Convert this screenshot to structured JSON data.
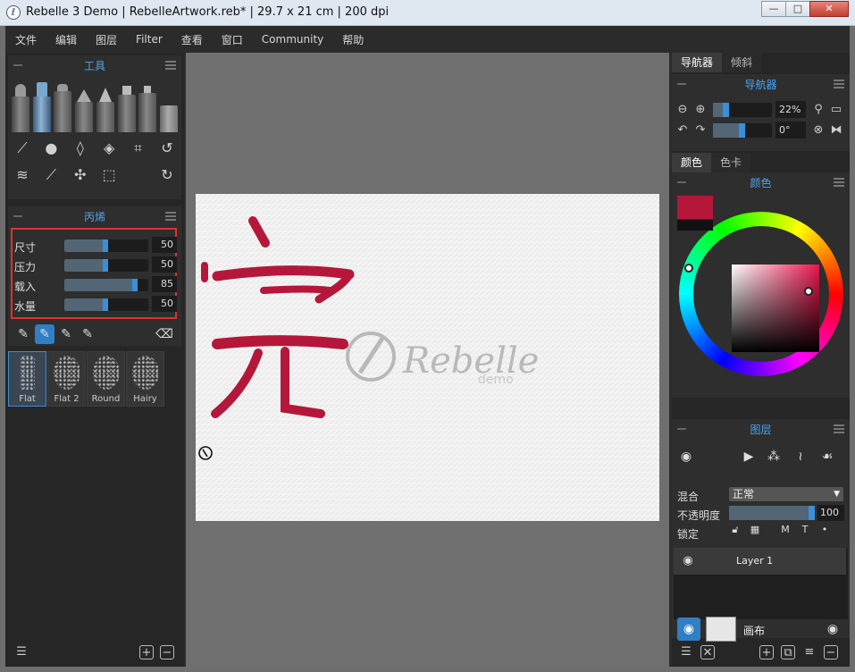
{
  "window": {
    "title": "Rebelle 3 Demo | RebelleArtwork.reb* | 29.7 x 21 cm | 200 dpi",
    "minimize": "—",
    "maximize": "□",
    "close": "✕"
  },
  "menu": [
    "文件",
    "编辑",
    "图层",
    "Filter",
    "查看",
    "窗口",
    "Community",
    "帮助"
  ],
  "tools_panel": {
    "title": "工具"
  },
  "paint_panel": {
    "title": "丙烯",
    "sliders": [
      {
        "label": "尺寸",
        "value": "50",
        "level": 0.5
      },
      {
        "label": "压力",
        "value": "50",
        "level": 0.5
      },
      {
        "label": "载入",
        "value": "85",
        "level": 0.85
      },
      {
        "label": "水量",
        "value": "50",
        "level": 0.5
      }
    ]
  },
  "presets": [
    {
      "label": "Flat",
      "selected": true
    },
    {
      "label": "Flat 2",
      "selected": false
    },
    {
      "label": "Round",
      "selected": false
    },
    {
      "label": "Hairy",
      "selected": false
    }
  ],
  "right_tabs_top": [
    "导航器",
    "倾斜"
  ],
  "navigator": {
    "title": "导航器",
    "zoom": "22%",
    "zoom_level": 0.22,
    "rotation": "0°",
    "rotation_level": 0.5
  },
  "right_tabs_mid": [
    "颜色",
    "色卡"
  ],
  "color_panel": {
    "title": "颜色",
    "foreground": "#b5173a",
    "background": "#111111"
  },
  "layers_panel": {
    "title": "图层",
    "blend_label": "混合",
    "blend_value": "正常",
    "opacity_label": "不透明度",
    "opacity_value": "100",
    "opacity_level": 1.0,
    "lock_label": "锁定",
    "lock_icons": [
      "M",
      "T"
    ],
    "layer_name": "Layer 1",
    "canvas_name": "画布"
  },
  "canvas": {
    "watermark_brand": "Rebelle",
    "watermark_sub": "demo",
    "stroke_color": "#b5173a"
  }
}
